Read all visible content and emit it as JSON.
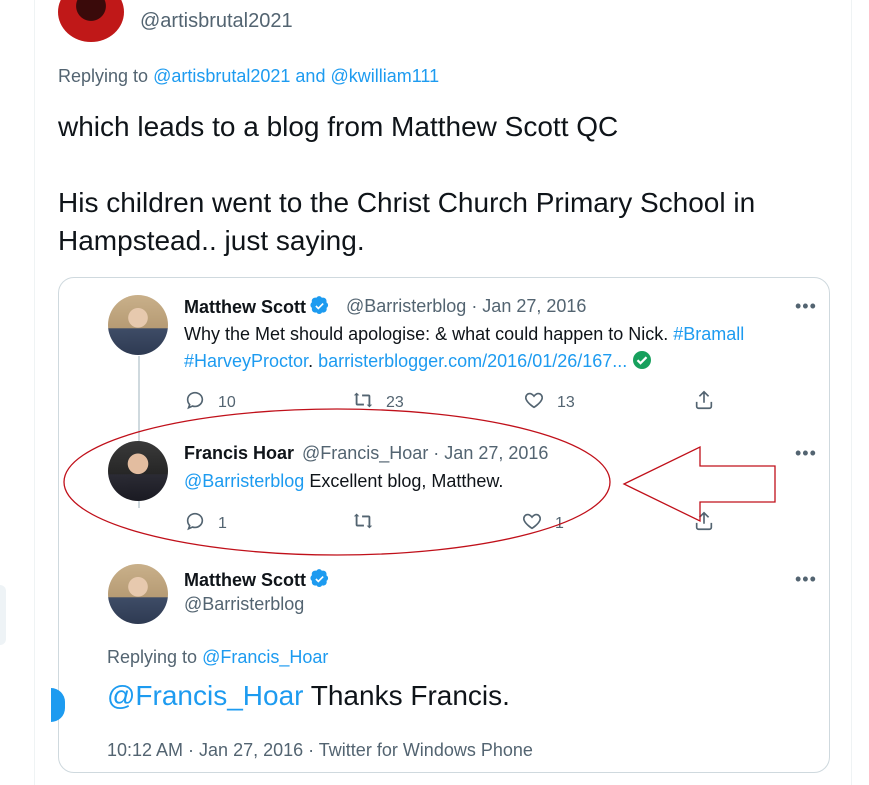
{
  "top_tweet": {
    "handle": "@artisbrutal2021",
    "replying_prefix": "Replying to ",
    "replying_user1": "@artisbrutal2021",
    "replying_and": " and ",
    "replying_user2": "@kwilliam111",
    "text_line1": "which leads to a blog from Matthew Scott QC",
    "text_line2": "His children went to the Christ Church Primary School in Hampstead.. just saying."
  },
  "quoted_thread": {
    "tweet1": {
      "name": "Matthew Scott",
      "handle_date": "@Barristerblog · Jan 27, 2016",
      "text_plain": "Why the Met should apologise: & what could happen to Nick. ",
      "hashtag1": "#Bramall",
      "hashtag2": "#HarveyProctor",
      "link": "barristerblogger.com/2016/01/26/167...",
      "more": "•••",
      "replies": "10",
      "retweets": "23",
      "likes": "13"
    },
    "tweet2": {
      "name": "Francis Hoar",
      "handle_date": "@Francis_Hoar · Jan 27, 2016",
      "mention": "@Barristerblog",
      "text_plain": " Excellent blog, Matthew.",
      "more": "•••",
      "replies": "1",
      "retweets": "",
      "likes": "1"
    },
    "tweet3": {
      "name": "Matthew Scott",
      "handle": "@Barristerblog",
      "more": "•••",
      "replying_prefix": "Replying to ",
      "replying_user": "@Francis_Hoar",
      "mention": "@Francis_Hoar",
      "text_plain": " Thanks Francis.",
      "timestamp": "10:12 AM · Jan 27, 2016 · Twitter for Windows Phone"
    }
  },
  "colors": {
    "link": "#1d9bf0",
    "secondary_text": "#536471",
    "annotation_red": "#c0101a"
  },
  "icons": {
    "verified": "verified-badge-icon",
    "check": "check-circle-icon",
    "reply": "reply-icon",
    "retweet": "retweet-icon",
    "like": "heart-icon",
    "share": "share-icon"
  }
}
